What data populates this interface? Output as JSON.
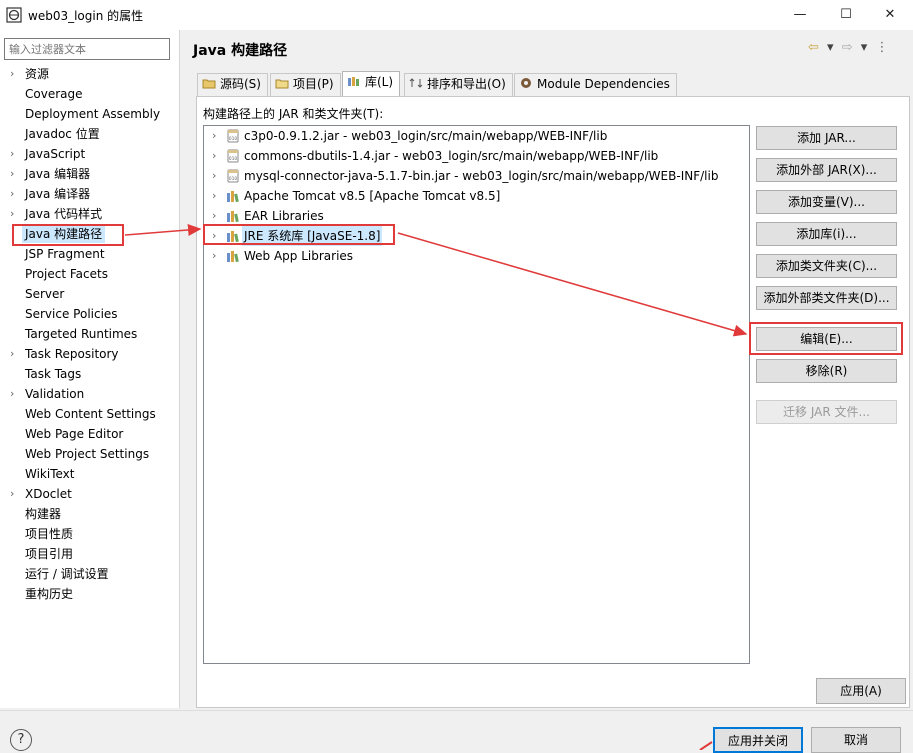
{
  "window": {
    "title": "web03_login 的属性",
    "minimize_glyph": "—",
    "maximize_glyph": "☐",
    "close_glyph": "✕"
  },
  "sidebar": {
    "filter_placeholder": "输入过滤器文本",
    "items": [
      {
        "label": "资源",
        "expandable": true
      },
      {
        "label": "Coverage",
        "expandable": false
      },
      {
        "label": "Deployment Assembly",
        "expandable": false
      },
      {
        "label": "Javadoc 位置",
        "expandable": false
      },
      {
        "label": "JavaScript",
        "expandable": true
      },
      {
        "label": "Java 编辑器",
        "expandable": true
      },
      {
        "label": "Java 编译器",
        "expandable": true
      },
      {
        "label": "Java 代码样式",
        "expandable": true
      },
      {
        "label": "Java 构建路径",
        "expandable": false,
        "selected": true
      },
      {
        "label": "JSP Fragment",
        "expandable": false
      },
      {
        "label": "Project Facets",
        "expandable": false
      },
      {
        "label": "Server",
        "expandable": false
      },
      {
        "label": "Service Policies",
        "expandable": false
      },
      {
        "label": "Targeted Runtimes",
        "expandable": false
      },
      {
        "label": "Task Repository",
        "expandable": true
      },
      {
        "label": "Task Tags",
        "expandable": false
      },
      {
        "label": "Validation",
        "expandable": true
      },
      {
        "label": "Web Content Settings",
        "expandable": false
      },
      {
        "label": "Web Page Editor",
        "expandable": false
      },
      {
        "label": "Web Project Settings",
        "expandable": false
      },
      {
        "label": "WikiText",
        "expandable": false
      },
      {
        "label": "XDoclet",
        "expandable": true
      },
      {
        "label": "构建器",
        "expandable": false
      },
      {
        "label": "项目性质",
        "expandable": false
      },
      {
        "label": "项目引用",
        "expandable": false
      },
      {
        "label": "运行 / 调试设置",
        "expandable": false
      },
      {
        "label": "重构历史",
        "expandable": false
      }
    ]
  },
  "header": {
    "title": "Java 构建路径",
    "nav_back": "⇦",
    "nav_forward": "⇨",
    "nav_menu": "▾"
  },
  "tabs": [
    {
      "label": "源码(S)",
      "active": false
    },
    {
      "label": "项目(P)",
      "active": false
    },
    {
      "label": "库(L)",
      "active": true
    },
    {
      "label": "排序和导出(O)",
      "active": false
    },
    {
      "label": "Module Dependencies",
      "active": false
    }
  ],
  "libraries": {
    "label": "构建路径上的 JAR 和类文件夹(T):",
    "items": [
      {
        "label": "c3p0-0.9.1.2.jar  -  web03_login/src/main/webapp/WEB-INF/lib",
        "icon": "jar-icon"
      },
      {
        "label": "commons-dbutils-1.4.jar  -  web03_login/src/main/webapp/WEB-INF/lib",
        "icon": "jar-icon"
      },
      {
        "label": "mysql-connector-java-5.1.7-bin.jar  -  web03_login/src/main/webapp/WEB-INF/lib",
        "icon": "jar-icon"
      },
      {
        "label": "Apache Tomcat v8.5 [Apache Tomcat v8.5]",
        "icon": "library-icon"
      },
      {
        "label": "EAR Libraries",
        "icon": "library-icon"
      },
      {
        "label": "JRE 系统库 [JavaSE-1.8]",
        "icon": "library-icon",
        "selected": true
      },
      {
        "label": "Web App Libraries",
        "icon": "library-icon"
      }
    ]
  },
  "buttons": {
    "add_jar": "添加 JAR...",
    "add_external_jar": "添加外部 JAR(X)...",
    "add_variable": "添加变量(V)...",
    "add_library": "添加库(i)...",
    "add_class_folder": "添加类文件夹(C)...",
    "add_external_class_folder": "添加外部类文件夹(D)...",
    "edit": "编辑(E)...",
    "remove": "移除(R)",
    "migrate_jar": "迁移 JAR 文件...",
    "apply": "应用(A)",
    "apply_and_close": "应用并关闭",
    "cancel": "取消"
  },
  "help": "?",
  "colors": {
    "annotation_red": "#e03a3a",
    "selection_blue": "#cce8ff",
    "default_button_border": "#0078d7"
  }
}
